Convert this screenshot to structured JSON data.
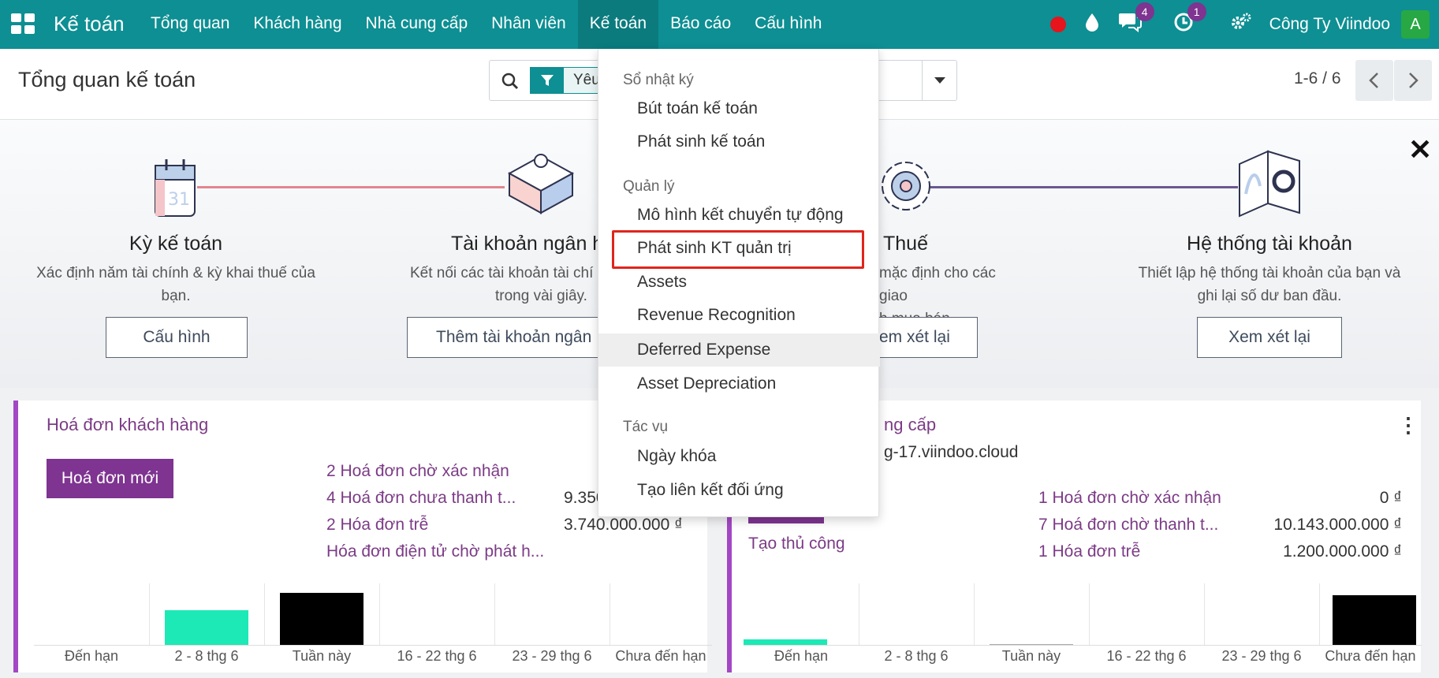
{
  "navbar": {
    "brand": "Kế toán",
    "menu": [
      "Tổng quan",
      "Khách hàng",
      "Nhà cung cấp",
      "Nhân viên",
      "Kế toán",
      "Báo cáo",
      "Cấu hình"
    ],
    "active_index": 4,
    "messages_count": "4",
    "activities_count": "1",
    "company": "Công Ty Viindoo",
    "avatar_initial": "A",
    "icons": [
      "apps-grid-icon",
      "record-dot-icon",
      "drop-icon",
      "chat-icon",
      "clock-icon",
      "settings-icon"
    ]
  },
  "control": {
    "title": "Tổng quan kế toán",
    "facet": "Yêu",
    "pager": "1-6 / 6"
  },
  "onboarding": {
    "steps": [
      {
        "title": "Kỳ kế toán",
        "desc1": "Xác định năm tài chính & kỳ khai thuế của",
        "desc2": "bạn.",
        "button": "Cấu hình"
      },
      {
        "title": "Tài khoản ngân h",
        "desc1": "Kết nối các tài khoản tài chí",
        "desc2": "trong vài giây.",
        "button": "Thêm tài khoản ngân"
      },
      {
        "title": "Thuế",
        "desc1": "mặc định cho các giao",
        "desc2": "h mua bán.",
        "button": "em xét lại"
      },
      {
        "title": "Hệ thống tài khoản",
        "desc1": "Thiết lập hệ thống tài khoản của bạn và",
        "desc2": "ghi lại số dư ban đầu.",
        "button": "Xem xét lại"
      }
    ]
  },
  "cards": {
    "left": {
      "title": "Hoá đơn khách hàng",
      "button": "Hoá đơn mới",
      "rows": [
        {
          "label": "2 Hoá đơn chờ xác nhận",
          "amount": ""
        },
        {
          "label": "4 Hoá đơn chưa thanh t...",
          "amount": "9.350"
        },
        {
          "label": "2 Hóa đơn trễ",
          "amount": "3.740.000.000 ₫"
        },
        {
          "label": "Hóa đơn điện tử chờ phát h...",
          "amount": ""
        }
      ],
      "graph_labels": [
        "Đến hạn",
        "2 - 8 thg 6",
        "Tuần này",
        "16 - 22 thg 6",
        "23 - 29 thg 6",
        "Chưa đến hạn"
      ]
    },
    "right": {
      "title": "ng cấp",
      "subtitle": "g-17.viindoo.cloud",
      "manual_link": "Tạo thủ công",
      "rows": [
        {
          "label": "1 Hoá đơn chờ xác nhận",
          "amount": "0 ₫"
        },
        {
          "label": "7 Hoá đơn chờ thanh t...",
          "amount": "10.143.000.000 ₫"
        },
        {
          "label": "1 Hóa đơn trễ",
          "amount": "1.200.000.000 ₫"
        }
      ],
      "graph_labels": [
        "Đến hạn",
        "2 - 8 thg 6",
        "Tuần này",
        "16 - 22 thg 6",
        "23 - 29 thg 6",
        "Chưa đến hạn"
      ]
    }
  },
  "dropdown": {
    "sections": [
      {
        "header": "Sổ nhật ký",
        "items": [
          "Bút toán kế toán",
          "Phát sinh kế toán"
        ]
      },
      {
        "header": "Quản lý",
        "items": [
          "Mô hình kết chuyển tự động",
          "Phát sinh KT quản trị",
          "Assets",
          "Revenue Recognition",
          "Deferred Expense",
          "Asset Depreciation"
        ]
      },
      {
        "header": "Tác vụ",
        "items": [
          "Ngày khóa",
          "Tạo liên kết đối ứng"
        ]
      }
    ],
    "highlighted_item": "Phát sinh KT quản trị",
    "hovered_item": "Deferred Expense"
  },
  "colors": {
    "navbar": "#0d8f93",
    "primary": "#7e3490",
    "card_accent": "#a347c4",
    "highlight_border": "#e0241b",
    "bar_green": "#1de9b6",
    "bar_black": "#000000"
  }
}
